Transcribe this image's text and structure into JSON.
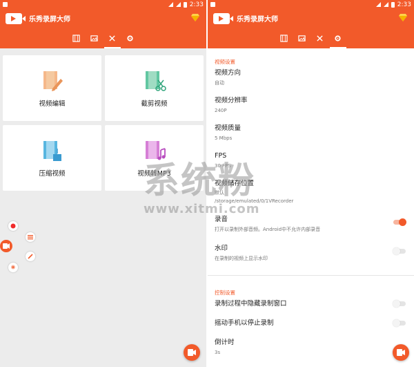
{
  "status_bar": {
    "time": "2:33"
  },
  "app": {
    "title": "乐秀录屏大师"
  },
  "tabs": [
    {
      "icon": "film-icon"
    },
    {
      "icon": "image-icon"
    },
    {
      "icon": "tools-icon"
    },
    {
      "icon": "gear-icon"
    }
  ],
  "tools": [
    {
      "label": "视频编辑",
      "icon": "video-edit-icon",
      "color": "#f5b88a"
    },
    {
      "label": "截剪视频",
      "icon": "video-cut-icon",
      "color": "#62c7a2"
    },
    {
      "label": "压缩视频",
      "icon": "video-compress-icon",
      "color": "#57b6e0"
    },
    {
      "label": "视频转MP3",
      "icon": "video-to-mp3-icon",
      "color": "#d67fd6"
    }
  ],
  "settings": {
    "video_section": "视频设置",
    "orientation": {
      "title": "视频方向",
      "value": "自动"
    },
    "resolution": {
      "title": "视频分辨率",
      "value": "240P"
    },
    "quality": {
      "title": "视频质量",
      "value": "5 Mbps"
    },
    "fps": {
      "title": "FPS",
      "value": "30 FPS"
    },
    "storage": {
      "title": "视频储存位置",
      "value": "默认",
      "path": "/storage/emulated/0/1VRecorder"
    },
    "audio": {
      "title": "录音",
      "desc": "打开以录制外部音频。Android中不允许内部录音",
      "enabled": true
    },
    "watermark": {
      "title": "水印",
      "desc": "在录制的视频上显示水印",
      "enabled": false
    },
    "control_section": "控制设置",
    "hide_window": {
      "title": "录制过程中隐藏录制窗口",
      "enabled": false
    },
    "shake_stop": {
      "title": "摇动手机以停止录制",
      "enabled": false
    },
    "countdown": {
      "title": "倒计时",
      "value": "3s"
    }
  },
  "watermark_overlay": {
    "text": "系统粉",
    "url": "www.xitmi.com"
  },
  "colors": {
    "accent": "#f25a2a",
    "background": "#ececec"
  }
}
